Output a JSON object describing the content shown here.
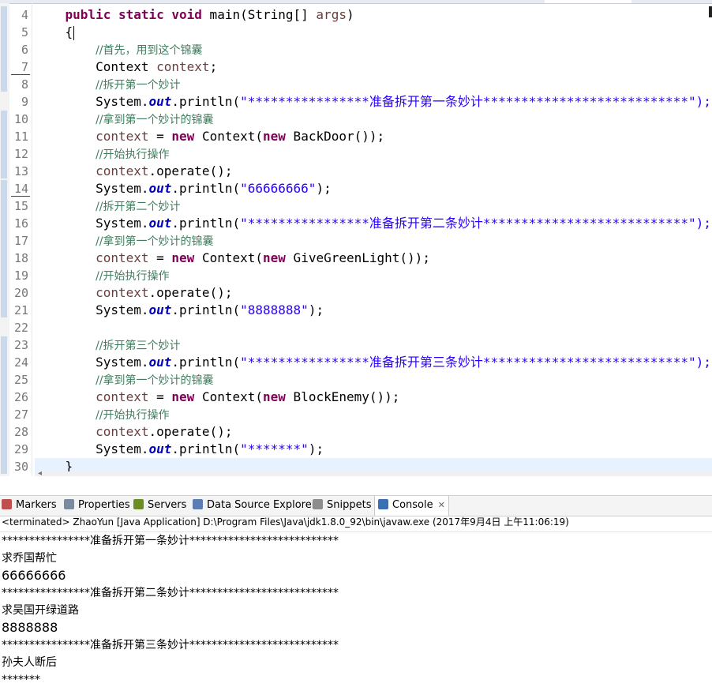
{
  "editor": {
    "line_numbers": [
      "4",
      "5",
      "6",
      "7",
      "8",
      "9",
      "10",
      "11",
      "12",
      "13",
      "14",
      "15",
      "16",
      "17",
      "18",
      "19",
      "20",
      "21",
      "22",
      "23",
      "24",
      "25",
      "26",
      "27",
      "28",
      "29",
      "30"
    ],
    "code_lines": [
      [
        {
          "t": "    "
        },
        {
          "t": "public static void",
          "c": "kw"
        },
        {
          "t": " main(String[] "
        },
        {
          "t": "args",
          "c": "vr"
        },
        {
          "t": ")"
        }
      ],
      [
        {
          "t": "    {"
        }
      ],
      [
        {
          "t": "        "
        },
        {
          "t": "//首先，用到这个锦囊",
          "c": "cm"
        }
      ],
      [
        {
          "t": "        Context "
        },
        {
          "t": "context",
          "c": "vr"
        },
        {
          "t": ";"
        }
      ],
      [
        {
          "t": "        "
        },
        {
          "t": "//拆开第一个妙计",
          "c": "cm"
        }
      ],
      [
        {
          "t": "        System."
        },
        {
          "t": "out",
          "c": "fd"
        },
        {
          "t": ".println("
        },
        {
          "t": "\"****************准备拆开第一条妙计***************************\");",
          "c": "st"
        }
      ],
      [
        {
          "t": "        "
        },
        {
          "t": "//拿到第一个妙计的锦囊",
          "c": "cm"
        }
      ],
      [
        {
          "t": "        "
        },
        {
          "t": "context",
          "c": "vr"
        },
        {
          "t": " = "
        },
        {
          "t": "new",
          "c": "kw"
        },
        {
          "t": " Context("
        },
        {
          "t": "new",
          "c": "kw"
        },
        {
          "t": " BackDoor());"
        }
      ],
      [
        {
          "t": "        "
        },
        {
          "t": "//开始执行操作",
          "c": "cm"
        }
      ],
      [
        {
          "t": "        "
        },
        {
          "t": "context",
          "c": "vr"
        },
        {
          "t": ".operate();"
        }
      ],
      [
        {
          "t": "        System."
        },
        {
          "t": "out",
          "c": "fd"
        },
        {
          "t": ".println("
        },
        {
          "t": "\"66666666\"",
          "c": "st"
        },
        {
          "t": ");"
        }
      ],
      [
        {
          "t": "        "
        },
        {
          "t": "//拆开第二个妙计",
          "c": "cm"
        }
      ],
      [
        {
          "t": "        System."
        },
        {
          "t": "out",
          "c": "fd"
        },
        {
          "t": ".println("
        },
        {
          "t": "\"****************准备拆开第二条妙计***************************\");",
          "c": "st"
        }
      ],
      [
        {
          "t": "        "
        },
        {
          "t": "//拿到第一个妙计的锦囊",
          "c": "cm"
        }
      ],
      [
        {
          "t": "        "
        },
        {
          "t": "context",
          "c": "vr"
        },
        {
          "t": " = "
        },
        {
          "t": "new",
          "c": "kw"
        },
        {
          "t": " Context("
        },
        {
          "t": "new",
          "c": "kw"
        },
        {
          "t": " GiveGreenLight());"
        }
      ],
      [
        {
          "t": "        "
        },
        {
          "t": "//开始执行操作",
          "c": "cm"
        }
      ],
      [
        {
          "t": "        "
        },
        {
          "t": "context",
          "c": "vr"
        },
        {
          "t": ".operate();"
        }
      ],
      [
        {
          "t": "        System."
        },
        {
          "t": "out",
          "c": "fd"
        },
        {
          "t": ".println("
        },
        {
          "t": "\"8888888\"",
          "c": "st"
        },
        {
          "t": ");"
        }
      ],
      [
        {
          "t": ""
        }
      ],
      [
        {
          "t": "        "
        },
        {
          "t": "//拆开第三个妙计",
          "c": "cm"
        }
      ],
      [
        {
          "t": "        System."
        },
        {
          "t": "out",
          "c": "fd"
        },
        {
          "t": ".println("
        },
        {
          "t": "\"****************准备拆开第三条妙计***************************\");",
          "c": "st"
        }
      ],
      [
        {
          "t": "        "
        },
        {
          "t": "//拿到第一个妙计的锦囊",
          "c": "cm"
        }
      ],
      [
        {
          "t": "        "
        },
        {
          "t": "context",
          "c": "vr"
        },
        {
          "t": " = "
        },
        {
          "t": "new",
          "c": "kw"
        },
        {
          "t": " Context("
        },
        {
          "t": "new",
          "c": "kw"
        },
        {
          "t": " BlockEnemy());"
        }
      ],
      [
        {
          "t": "        "
        },
        {
          "t": "//开始执行操作",
          "c": "cm"
        }
      ],
      [
        {
          "t": "        "
        },
        {
          "t": "context",
          "c": "vr"
        },
        {
          "t": ".operate();"
        }
      ],
      [
        {
          "t": "        System."
        },
        {
          "t": "out",
          "c": "fd"
        },
        {
          "t": ".println("
        },
        {
          "t": "\"*******\"",
          "c": "st"
        },
        {
          "t": ");"
        }
      ],
      [
        {
          "t": "    }"
        }
      ]
    ]
  },
  "panel_tabs": [
    {
      "id": "markers",
      "label": "Markers",
      "icon": "markers-icon",
      "color": "#c0504d"
    },
    {
      "id": "properties",
      "label": "Properties",
      "icon": "properties-icon",
      "color": "#7a8aa0"
    },
    {
      "id": "servers",
      "label": "Servers",
      "icon": "servers-icon",
      "color": "#6b8e23"
    },
    {
      "id": "data-source-explorer",
      "label": "Data Source Explorer",
      "icon": "database-icon",
      "color": "#5b7db1"
    },
    {
      "id": "snippets",
      "label": "Snippets",
      "icon": "snippets-icon",
      "color": "#8d8d8d"
    },
    {
      "id": "console",
      "label": "Console",
      "icon": "console-icon",
      "color": "#3c6eb4",
      "active": true,
      "close": "✕"
    }
  ],
  "console": {
    "status": "<terminated> ZhaoYun [Java Application] D:\\Program Files\\Java\\jdk1.8.0_92\\bin\\javaw.exe (2017年9月4日 上午11:06:19)",
    "output": [
      {
        "text": "****************准备拆开第一条妙计***************************",
        "size": "sm"
      },
      {
        "text": "求乔国帮忙",
        "size": "sm"
      },
      {
        "text": "66666666",
        "size": "big"
      },
      {
        "text": "****************准备拆开第二条妙计***************************",
        "size": "sm"
      },
      {
        "text": "求吴国开绿道路",
        "size": "sm"
      },
      {
        "text": "8888888",
        "size": "big"
      },
      {
        "text": "****************准备拆开第三条妙计***************************",
        "size": "sm"
      },
      {
        "text": "孙夫人断后",
        "size": "sm"
      },
      {
        "text": "*******",
        "size": "sm"
      }
    ]
  },
  "colors": {
    "keyword": "#7f0055",
    "comment": "#3f7f5f",
    "string": "#2a00ff",
    "field": "#0000c0",
    "variable": "#6a3e3e",
    "current_line": "#e8f2fe"
  }
}
